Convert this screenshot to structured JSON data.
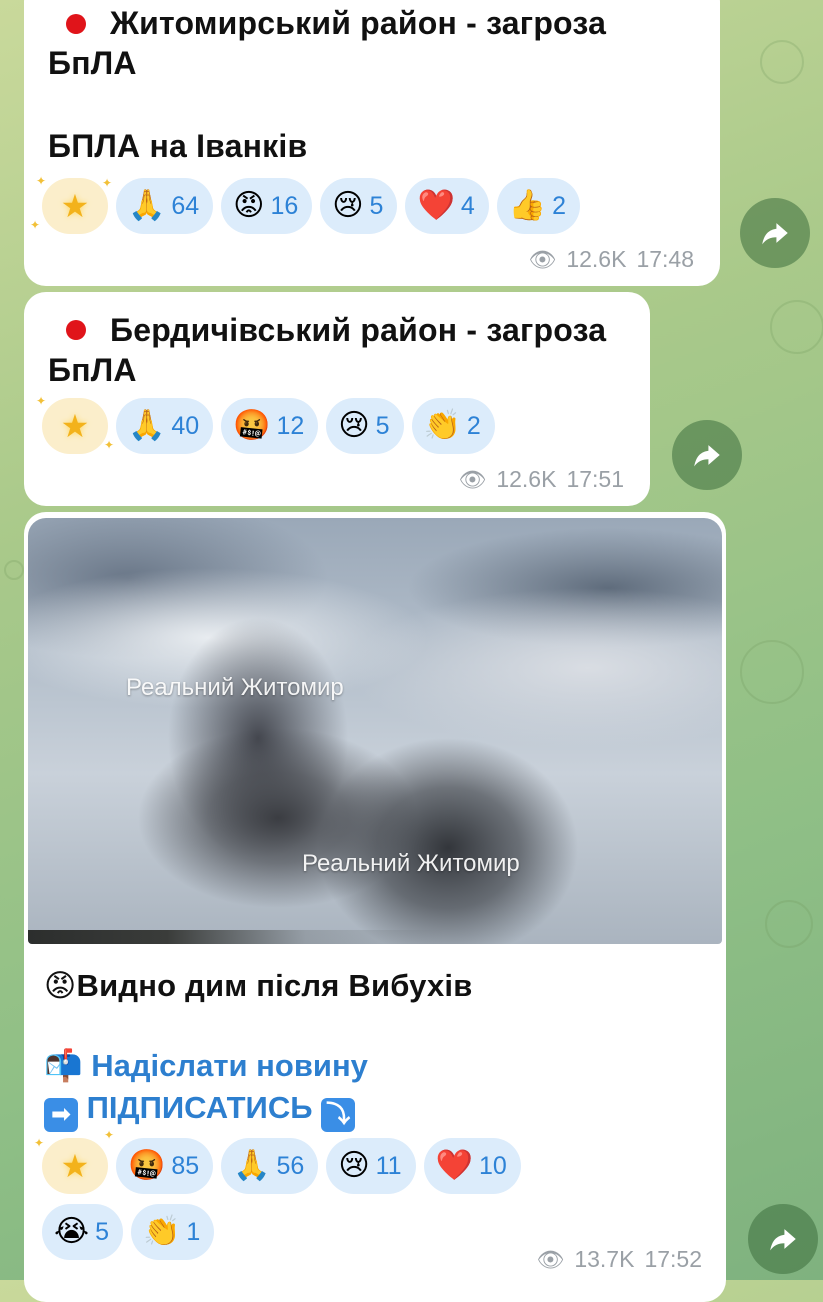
{
  "messages": [
    {
      "title_line1": "Житомирський район - загроза",
      "title_line2": "БпЛА",
      "body": "БПЛА на Іванків",
      "reactions": [
        {
          "emoji": "🙏",
          "count": "64"
        },
        {
          "emoji": "😡",
          "count": "16"
        },
        {
          "emoji": "😢",
          "count": "5"
        },
        {
          "emoji": "❤️",
          "count": "4"
        },
        {
          "emoji": "👍",
          "count": "2"
        }
      ],
      "views": "12.6K",
      "time": "17:48"
    },
    {
      "title_line1": "Бердичівський район - загроза",
      "title_line2": "БпЛА",
      "reactions": [
        {
          "emoji": "🙏",
          "count": "40"
        },
        {
          "emoji": "🤬",
          "count": "12"
        },
        {
          "emoji": "😢",
          "count": "5"
        },
        {
          "emoji": "👏",
          "count": "2"
        }
      ],
      "views": "12.6K",
      "time": "17:51"
    },
    {
      "watermark1": "Реальний Житомир",
      "watermark2": "Реальний Житомир",
      "caption_emoji": "😡",
      "caption": "Видно дим після Вибухів",
      "link1_icon": "📬",
      "link1": "Надіслати новину",
      "link2_icon": "➡",
      "link2": "ПІДПИСАТИСЬ",
      "link2_tail_icon": "⤵",
      "reactions_row1": [
        {
          "emoji": "🤬",
          "count": "85"
        },
        {
          "emoji": "🙏",
          "count": "56"
        },
        {
          "emoji": "😢",
          "count": "11"
        },
        {
          "emoji": "❤️",
          "count": "10"
        }
      ],
      "reactions_row2": [
        {
          "emoji": "😭",
          "count": "5"
        },
        {
          "emoji": "👏",
          "count": "1"
        }
      ],
      "views": "13.7K",
      "time": "17:52"
    }
  ],
  "icons": {
    "star": "★",
    "eye": "👁",
    "share": "share-arrow-icon"
  },
  "colors": {
    "reaction_bg": "#dcecfb",
    "reaction_count": "#2d82d6",
    "link": "#2d7fcf",
    "meta": "#9aa0a6"
  }
}
